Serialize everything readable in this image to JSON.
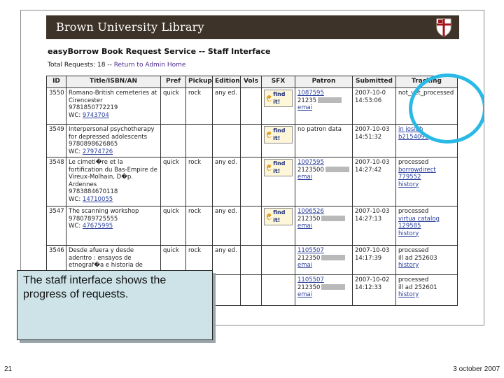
{
  "banner": {
    "title": "Brown University Library",
    "shield_icon": "brown-university-shield-icon"
  },
  "app_title": "easyBorrow Book Request Service -- Staff Interface",
  "totals": {
    "label": "Total Requests: 18 --",
    "link": "Return to Admin Home"
  },
  "columns": [
    "ID",
    "Title/ISBN/AN",
    "Pref",
    "Pickup",
    "Edition",
    "Vols",
    "SFX",
    "Patron",
    "Submitted",
    "Tracking"
  ],
  "rows": [
    {
      "id": "3550",
      "title_lines": [
        "Romano-British cemeteries at",
        "Cirencester",
        "9781850772219"
      ],
      "wc_label": "WC:",
      "wc_link": "9743704",
      "pref": "quick",
      "pickup": "rock",
      "edition": "any ed.",
      "vols": "",
      "sfx": "find it!",
      "patron_link": "1087595",
      "patron_lines": [
        "21235",
        "emai"
      ],
      "submitted": [
        "2007-10-0",
        "14:53:06"
      ],
      "tracking": [
        "not_yet_processed"
      ],
      "tracking_links": []
    },
    {
      "id": "3549",
      "title_lines": [
        "Interpersonal psychotherapy",
        "for depressed adolescents",
        "9780898626865"
      ],
      "wc_label": "WC:",
      "wc_link": "27974726",
      "pref": "",
      "pickup": "",
      "edition": "",
      "vols": "",
      "sfx": "find it!",
      "patron_link": "",
      "patron_lines": [
        "no patron data"
      ],
      "submitted": [
        "2007-10-03",
        "14:51:32"
      ],
      "tracking": [],
      "tracking_links": [
        "in josiah",
        "b2154095"
      ]
    },
    {
      "id": "3548",
      "title_lines": [
        "Le cimeti�re et la",
        "fortification du Bas-Empire de",
        "Vireux-Molhain, D�p.",
        "Ardennes",
        "9783884670118"
      ],
      "wc_label": "WC:",
      "wc_link": "14710055",
      "pref": "quick",
      "pickup": "rock",
      "edition": "any ed.",
      "vols": "",
      "sfx": "find it!",
      "patron_link": "1007595",
      "patron_lines": [
        "2123500",
        "emai"
      ],
      "submitted": [
        "2007-10-03",
        "14:27:42"
      ],
      "tracking": [
        "processed"
      ],
      "tracking_links": [
        "borrowdirect",
        "779552",
        "history"
      ]
    },
    {
      "id": "3547",
      "title_lines": [
        "The scanning workshop",
        "9780789725555"
      ],
      "wc_label": "WC:",
      "wc_link": "47675995",
      "pref": "quick",
      "pickup": "rock",
      "edition": "any ed.",
      "vols": "",
      "sfx": "find it!",
      "patron_link": "1006526",
      "patron_lines": [
        "212350",
        "emai"
      ],
      "submitted": [
        "2007-10-03",
        "14:27:13"
      ],
      "tracking": [
        "processed"
      ],
      "tracking_links": [
        "virtua catalog",
        "129585",
        "history"
      ]
    },
    {
      "id": "3546",
      "title_lines": [
        "Desde afuera y desde",
        "adentro : ensayos de",
        "etnograf�a e historia de"
      ],
      "wc_label": "",
      "wc_link": "",
      "pref": "quick",
      "pickup": "rock",
      "edition": "any ed.",
      "vols": "",
      "sfx": "",
      "patron_link": "1105507",
      "patron_lines": [
        "212350",
        "emai"
      ],
      "submitted": [
        "2007-10-03",
        "14:17:39"
      ],
      "tracking": [
        "processed",
        "ill ad 252603"
      ],
      "tracking_links": [
        "history"
      ]
    },
    {
      "id": "",
      "title_lines": [],
      "wc_label": "",
      "wc_link": "",
      "pref": "",
      "pickup": "",
      "edition": "",
      "vols": "",
      "sfx": "",
      "patron_link": "1105507",
      "patron_lines": [
        "212350",
        "emai"
      ],
      "submitted": [
        "2007-10-02",
        "14:12:33"
      ],
      "tracking": [
        "processed",
        "ill ad 252601"
      ],
      "tracking_links": [
        "history"
      ]
    }
  ],
  "callout": "The staff interface shows the progress of requests.",
  "footer": {
    "slide_number": "21",
    "date": "3 october 2007"
  },
  "colors": {
    "banner": "#3e3328",
    "highlight_ring": "#29b9e6",
    "callout_bg": "#cde3e8"
  }
}
